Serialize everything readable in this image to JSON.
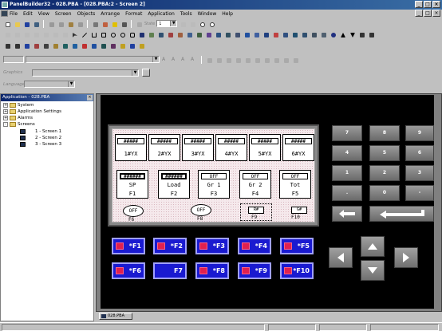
{
  "app": {
    "title": "PanelBuilder32 - 028.PBA - [028.PBA:2 - Screen 2]"
  },
  "menu": [
    "File",
    "Edit",
    "View",
    "Screen",
    "Objects",
    "Arrange",
    "Format",
    "Application",
    "Tools",
    "Window",
    "Help"
  ],
  "toolbar": {
    "zoom_value": "1",
    "state_label": "State"
  },
  "format_bar": {
    "graphics_label": "Graphics",
    "language_label": "Language"
  },
  "left_pane": {
    "title": "Application - 028.PBA",
    "tree": [
      {
        "label": "System",
        "kind": "folder",
        "expander": "+"
      },
      {
        "label": "Application Settings",
        "kind": "folder",
        "expander": "+"
      },
      {
        "label": "Alarms",
        "kind": "folder",
        "expander": "+"
      },
      {
        "label": "Screens",
        "kind": "folder",
        "expander": "-"
      },
      {
        "label": "1 - Screen 1",
        "kind": "screen"
      },
      {
        "label": "2 - Screen 2",
        "kind": "screen"
      },
      {
        "label": "3 - Screen 3",
        "kind": "screen"
      }
    ]
  },
  "hmi": {
    "top_displays": [
      {
        "value": "#####",
        "label": "1#YX"
      },
      {
        "value": "#####",
        "label": "2#YX"
      },
      {
        "value": "#####",
        "label": "3#YX"
      },
      {
        "value": "#####",
        "label": "4#YX"
      },
      {
        "value": "#####",
        "label": "5#YX"
      },
      {
        "value": "#####",
        "label": "6#YX"
      }
    ],
    "func_displays": [
      {
        "value": "######",
        "line1": "SP",
        "line2": "F1"
      },
      {
        "value": "######",
        "line1": "Load",
        "line2": "F2"
      },
      {
        "value": "OFF",
        "line1": "Gr 1",
        "line2": "F3"
      },
      {
        "value": "OFF",
        "line1": "Gr 2",
        "line2": "F4"
      },
      {
        "value": "OFF",
        "line1": "Tot",
        "line2": "F5"
      }
    ],
    "bottom": {
      "oval1": "OFF",
      "oval1_label": "F6",
      "oval2": "OFF",
      "oval2_label": "F8",
      "box1": "R#",
      "box1_label": "F9",
      "box2": "G#",
      "box2_label": "F10"
    },
    "numpad": [
      "7",
      "8",
      "9",
      "4",
      "5",
      "6",
      "1",
      "2",
      "3",
      ".",
      "0",
      "-"
    ],
    "fkeys_row1": [
      "*F1",
      "*F2",
      "*F3",
      "*F4",
      "*F5"
    ],
    "fkeys_row2": [
      "*F6",
      "F7",
      "*F8",
      "*F9",
      "*F10"
    ]
  },
  "doc_tab": "028.PBA",
  "colors": {
    "fkey_blue": "#1a1ad0",
    "lcd_bg": "#f5e9ec",
    "title_blue": "#0a246a"
  }
}
